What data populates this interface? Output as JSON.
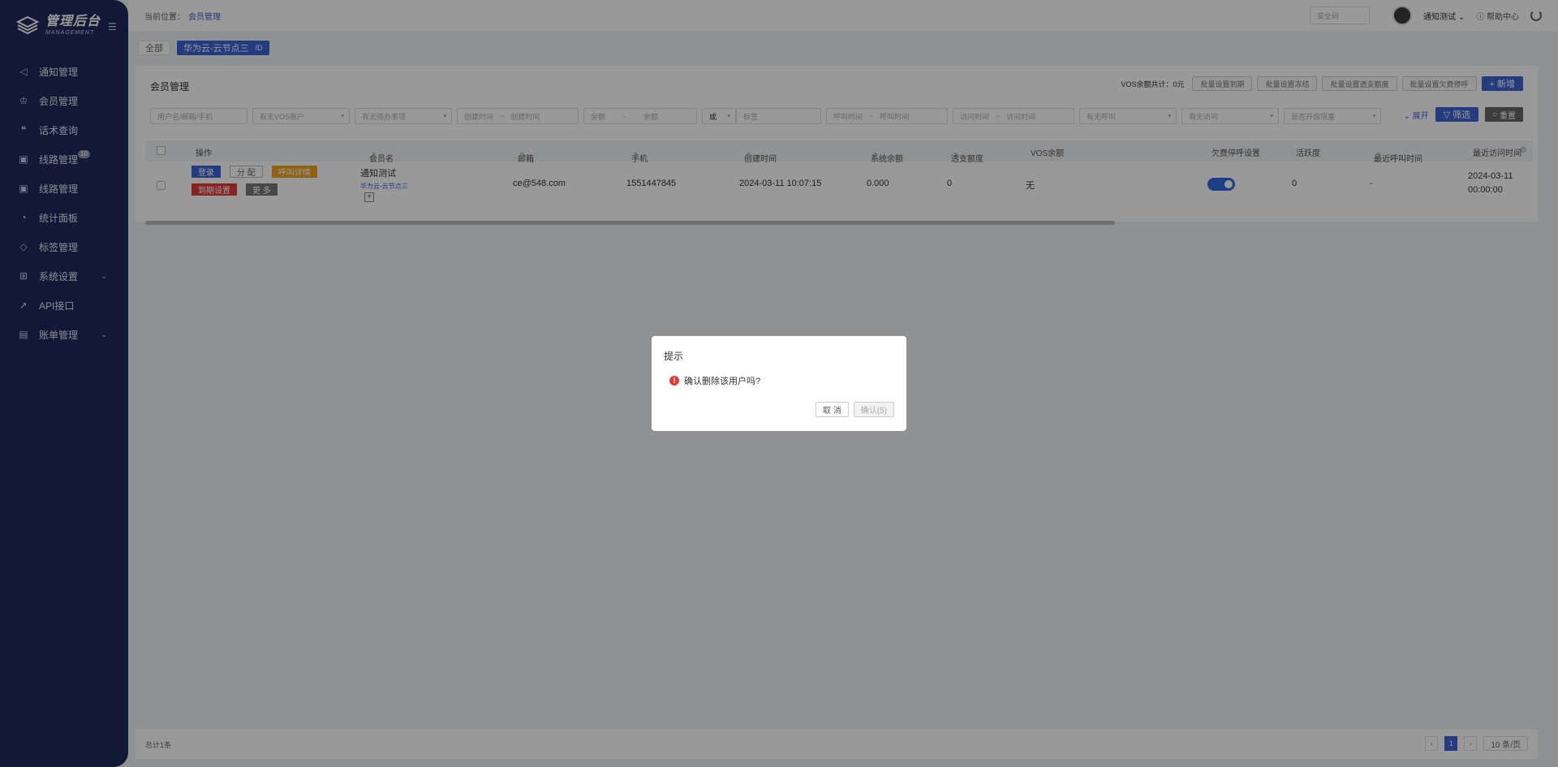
{
  "sidebar": {
    "brand": "管理后台",
    "brand_sub": "MANAGEMENT",
    "items": [
      {
        "label": "通知管理",
        "icon": "megaphone-icon"
      },
      {
        "label": "会员管理",
        "icon": "crown-icon"
      },
      {
        "label": "话术查询",
        "icon": "quote-icon"
      },
      {
        "label": "线路管理",
        "icon": "line-icon",
        "badge": "10"
      },
      {
        "label": "线路管理",
        "icon": "line-icon"
      },
      {
        "label": "统计面板",
        "icon": "pie-chart-icon"
      },
      {
        "label": "标签管理",
        "icon": "tag-icon"
      },
      {
        "label": "系统设置",
        "icon": "grid-icon",
        "expandable": true
      },
      {
        "label": "API接口",
        "icon": "rocket-icon"
      },
      {
        "label": "账单管理",
        "icon": "bill-icon",
        "expandable": true
      }
    ]
  },
  "header": {
    "crumb_prefix": "当前位置：",
    "crumb_link": "会员管理",
    "safe_placeholder": "安全码",
    "user_name": "通知测试",
    "help": "帮助中心"
  },
  "tabs": {
    "all": "全部",
    "active": "华为云-云节点三",
    "active_mark": "ID"
  },
  "main": {
    "title": "会员管理",
    "vos_total": "VOS余额共计：0元",
    "batch_buttons": [
      "批量设置到期",
      "批量设置冻结",
      "批量设置透支额度",
      "批量设置欠费停呼"
    ],
    "add_button": "+ 新增",
    "filters": {
      "user": "用户名/邮箱/手机",
      "vos_account": "有无VOS账户",
      "todo": "有无待办事项",
      "create_start": "创建时间",
      "create_end": "创建时间",
      "balance_min": "余额",
      "balance_max": "余额",
      "logic": "或",
      "label": "标签",
      "call_start": "呼叫时间",
      "call_end": "呼叫时间",
      "visit_start": "访问时间",
      "visit_end": "访问时间",
      "has_call": "有无呼叫",
      "has_visit": "有无访问",
      "blocked": "是否开启阻塞"
    },
    "expand": "展开",
    "filter_button": "筛选",
    "reset_button": "重置"
  },
  "table": {
    "columns": [
      "操作",
      "会员名",
      "邮箱",
      "手机",
      "创建时间",
      "系统余额",
      "透支额度",
      "VOS余额",
      "欠费停呼设置",
      "活跃度",
      "最近呼叫时间",
      "最近访问时间"
    ],
    "row": {
      "actions": [
        "登录",
        "分 配",
        "呼叫详情",
        "到期设置",
        "更 多"
      ],
      "member_name": "通知测试",
      "member_tag": "华为云-云节点三",
      "email": "ce@548.com",
      "phone": "1551447845",
      "created": "2024-03-11 10:07:15",
      "sys_balance": "0.000",
      "overdraft": "0",
      "vos_balance": "无",
      "arrears_stop": true,
      "activity": "0",
      "last_call": "-",
      "last_visit": "2024-03-11",
      "last_visit_time": "00:00:00"
    }
  },
  "footer": {
    "total": "总计1条",
    "current_page": "1",
    "page_size": "10 条/页"
  },
  "dialog": {
    "title": "提示",
    "message": "确认删除该用户吗?",
    "cancel": "取 消",
    "confirm": "确认(5)"
  },
  "colors": {
    "sidebar_bg": "#1e2a5a",
    "primary": "#3d63d6",
    "danger": "#e33b3b",
    "warning": "#f0a020"
  }
}
